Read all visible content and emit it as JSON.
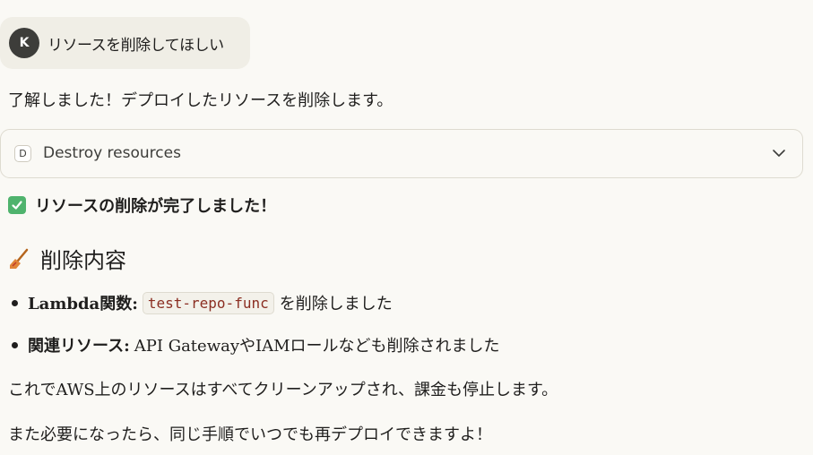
{
  "user_message": {
    "avatar_initial": "K",
    "text": "リソースを削除してほしい"
  },
  "assistant": {
    "intro": "了解しました！デプロイしたリソースを削除します。",
    "tool_call": {
      "badge": "D",
      "label": "Destroy resources",
      "icon": "chevron-down-icon"
    },
    "status": {
      "icon": "check-mark-button-icon",
      "text": "リソースの削除が完了しました！"
    },
    "heading": {
      "icon": "broom-icon",
      "text": "削除内容"
    },
    "bullets": [
      {
        "label": "Lambda関数:",
        "code": "test-repo-func",
        "text": "を削除しました"
      },
      {
        "label": "関連リソース:",
        "text": "API GatewayやIAMロールなども削除されました"
      }
    ],
    "paragraph_1": "これでAWS上のリソースはすべてクリーンアップされ、課金も停止します。",
    "paragraph_2": "また必要になったら、同じ手順でいつでも再デプロイできますよ！"
  },
  "colors": {
    "background": "#faf9f5",
    "user_bubble": "#f0eee6",
    "avatar": "#3d3d3a",
    "check": "#4fb36d",
    "code_text": "#8b2e22"
  }
}
